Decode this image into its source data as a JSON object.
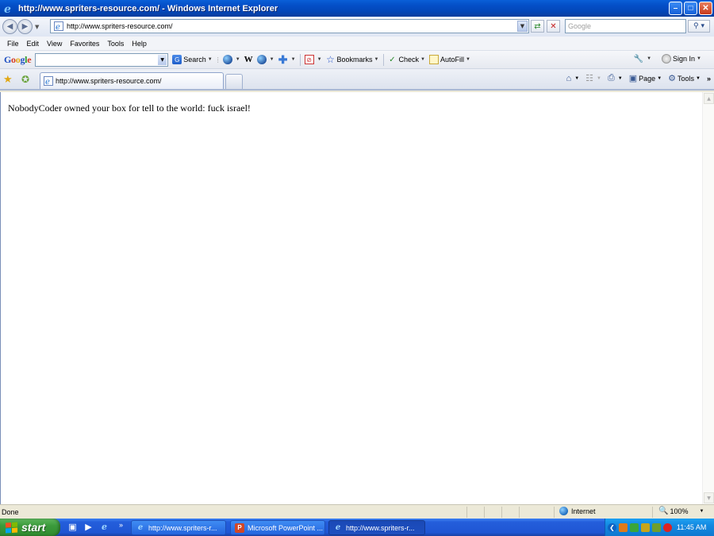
{
  "window": {
    "title": "http://www.spriters-resource.com/ - Windows Internet Explorer",
    "min_label": "–",
    "max_label": "□",
    "close_label": "✕"
  },
  "address_bar": {
    "url": "http://www.spriters-resource.com/",
    "search_placeholder": "Google"
  },
  "menu": [
    "File",
    "Edit",
    "View",
    "Favorites",
    "Tools",
    "Help"
  ],
  "google_toolbar": {
    "search_label": "Search",
    "wiki_label": "W",
    "bookmarks_label": "Bookmarks",
    "check_label": "Check",
    "autofill_label": "AutoFill",
    "sign_in_label": "Sign In"
  },
  "tabs": [
    {
      "label": "http://www.spriters-resource.com/"
    }
  ],
  "command_bar": {
    "page_label": "Page",
    "tools_label": "Tools",
    "more_label": "»"
  },
  "page": {
    "message": "NobodyCoder owned your box for tell to the world: fuck israel!"
  },
  "status": {
    "text": "Done",
    "zone": "Internet",
    "zoom": "100%"
  },
  "taskbar": {
    "start_label": "start",
    "more_label": "»",
    "buttons": [
      {
        "label": "http://www.spriters-r...",
        "app": "ie"
      },
      {
        "label": "Microsoft PowerPoint ...",
        "app": "powerpoint"
      },
      {
        "label": "http://www.spriters-r...",
        "app": "ie"
      }
    ],
    "clock": "11:45 AM"
  },
  "colors": {
    "xp_blue": "#0450c8",
    "start_green": "#3c9b3c",
    "tray_blue": "#1489e0"
  }
}
